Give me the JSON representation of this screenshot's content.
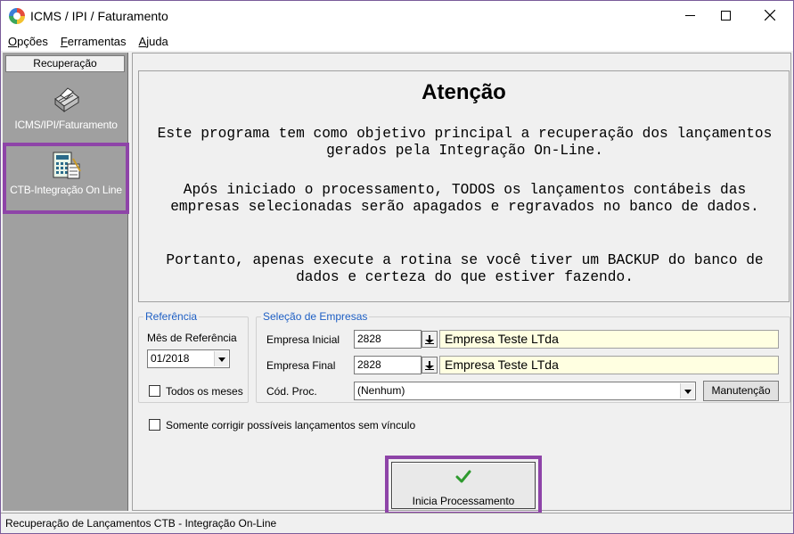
{
  "window": {
    "title": "ICMS / IPI / Faturamento",
    "controls": {
      "minimize": "minimize-icon",
      "maximize": "maximize-icon",
      "close": "close-icon"
    }
  },
  "menu": {
    "items": [
      {
        "accel": "O",
        "rest": "pções"
      },
      {
        "accel": "F",
        "rest": "erramentas"
      },
      {
        "accel": "A",
        "rest": "juda"
      }
    ]
  },
  "sidebar": {
    "header": "Recuperação",
    "items": [
      {
        "label": "ICMS/IPI/Faturamento",
        "icon": "printer-icon"
      },
      {
        "label": "CTB-Integração On Line",
        "icon": "calculator-ledger-icon",
        "selected": true
      }
    ],
    "highlight_color": "#8e44a8"
  },
  "notice": {
    "title": "Atenção",
    "paragraph1": "Este programa tem como objetivo principal a recuperação dos lançamentos gerados pela Integração On-Line.",
    "paragraph2": "Após iniciado o processamento, TODOS os lançamentos contábeis das empresas selecionadas serão apagados e regravados no banco de dados.",
    "paragraph3": "Portanto, apenas execute a rotina se você tiver um BACKUP do banco de dados e certeza do que estiver fazendo."
  },
  "referencia": {
    "legend": "Referência",
    "mes_label": "Mês de Referência",
    "mes_value": "01/2018",
    "todos_label": "Todos os meses",
    "todos_checked": false
  },
  "empresas": {
    "legend": "Seleção de Empresas",
    "inicial_label": "Empresa Inicial",
    "inicial_code": "2828",
    "inicial_name": "Empresa Teste LTda",
    "final_label": "Empresa Final",
    "final_code": "2828",
    "final_name": "Empresa Teste LTda",
    "cod_proc_label": "Cód. Proc.",
    "cod_proc_value": "(Nenhum)",
    "manutencao_label": "Manutenção"
  },
  "options": {
    "somente_label": "Somente corrigir possíveis lançamentos sem vínculo",
    "somente_checked": false
  },
  "action": {
    "start_label": "Inicia Processamento",
    "start_icon": "green-checkmark-icon",
    "accent": "#2e9a2e"
  },
  "status": {
    "text": "Recuperação de Lançamentos CTB - Integração On-Line"
  }
}
